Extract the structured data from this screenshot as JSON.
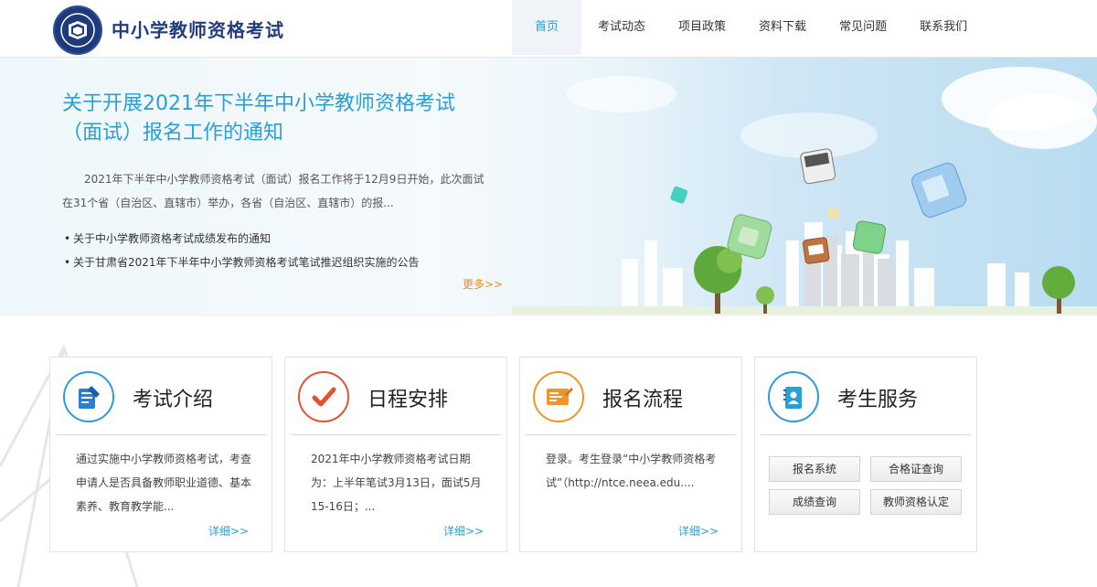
{
  "header": {
    "site_title": "中小学教师资格考试",
    "nav": [
      "首页",
      "考试动态",
      "项目政策",
      "资料下载",
      "常见问题",
      "联系我们"
    ]
  },
  "banner": {
    "headline": "关于开展2021年下半年中小学教师资格考试（面试）报名工作的通知",
    "summary": "2021年下半年中小学教师资格考试（面试）报名工作将于12月9日开始，此次面试在31个省（自治区、直辖市）举办，各省（自治区、直辖市）的报...",
    "news": [
      "关于中小学教师资格考试成绩发布的通知",
      "关于甘肃省2021年下半年中小学教师资格考试笔试推迟组织实施的公告"
    ],
    "more": "更多>>"
  },
  "cards": [
    {
      "title": "考试介绍",
      "body": "通过实施中小学教师资格考试，考查申请人是否具备教师职业道德、基本素养、教育教学能...",
      "more": "详细>>",
      "icon": "document-pencil-icon"
    },
    {
      "title": "日程安排",
      "body": "2021年中小学教师资格考试日期为：上半年笔试3月13日，面试5月15-16日；...",
      "more": "详细>>",
      "icon": "checkmark-icon"
    },
    {
      "title": "报名流程",
      "body": "登录。考生登录“中小学教师资格考试”（http://ntce.neea.edu....",
      "more": "详细>>",
      "icon": "application-form-icon"
    },
    {
      "title": "考生服务",
      "icon": "user-notebook-icon"
    }
  ],
  "services": [
    "报名系统",
    "合格证查询",
    "成绩查询",
    "教师资格认定"
  ],
  "colors": {
    "brand": "#223d7c",
    "accent": "#2a9fd6",
    "more": "#f08c1e",
    "red": "#e0532e",
    "orange": "#f0952a"
  }
}
